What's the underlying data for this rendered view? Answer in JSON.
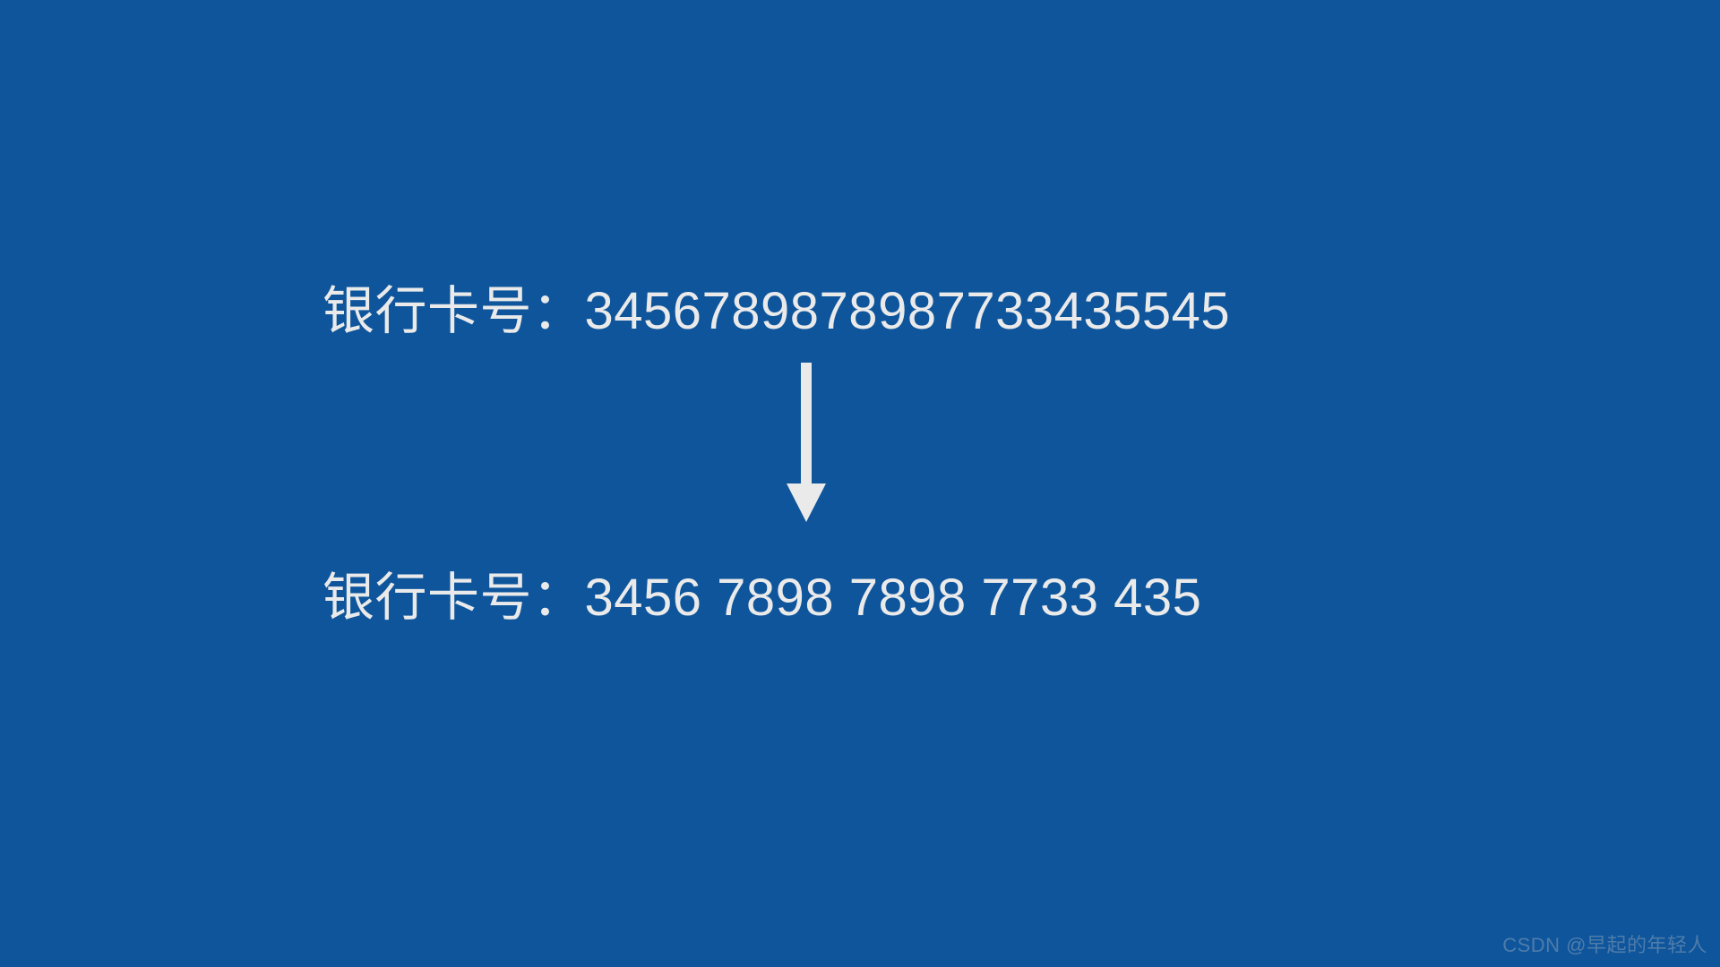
{
  "diagram": {
    "topLine": "银行卡号：345678987898773343554​5",
    "bottomLine": "银行卡号：3456  7898  7898  7733  435",
    "arrowColor": "#eaeaea"
  },
  "watermark": "CSDN @早起的年轻人",
  "colors": {
    "background": "#0e559c",
    "text": "#eaeaea"
  }
}
